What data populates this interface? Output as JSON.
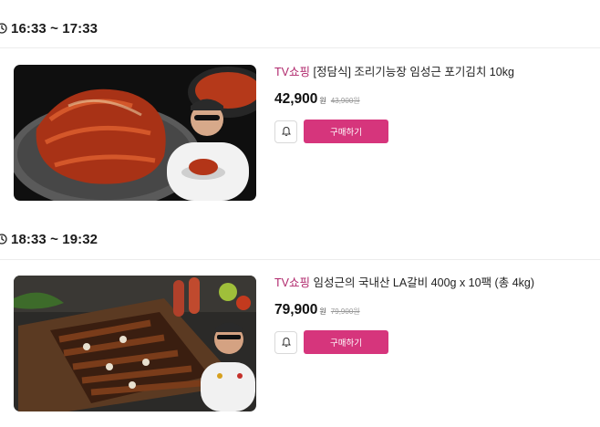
{
  "slots": [
    {
      "time": "16:33 ~ 17:33",
      "product": {
        "channel": "TV쇼핑",
        "name": "[정담식] 조리기능장 임성근 포기김치 10kg",
        "price": "42,900",
        "price_unit": "원",
        "original_price": "43,900원",
        "buy_label": "구매하기",
        "image": "kimchi-product-photo"
      }
    },
    {
      "time": "18:33 ~ 19:32",
      "product": {
        "channel": "TV쇼핑",
        "name": "임성근의 국내산 LA갈비 400g x 10팩 (총 4kg)",
        "price": "79,900",
        "price_unit": "원",
        "original_price": "79,900원",
        "buy_label": "구매하기",
        "image": "la-galbi-product-photo"
      }
    }
  ],
  "colors": {
    "accent": "#d6357c",
    "channel_text": "#b0286c",
    "divider": "#ececec"
  },
  "icons": {
    "time": "clock-icon",
    "alarm": "bell-icon"
  }
}
